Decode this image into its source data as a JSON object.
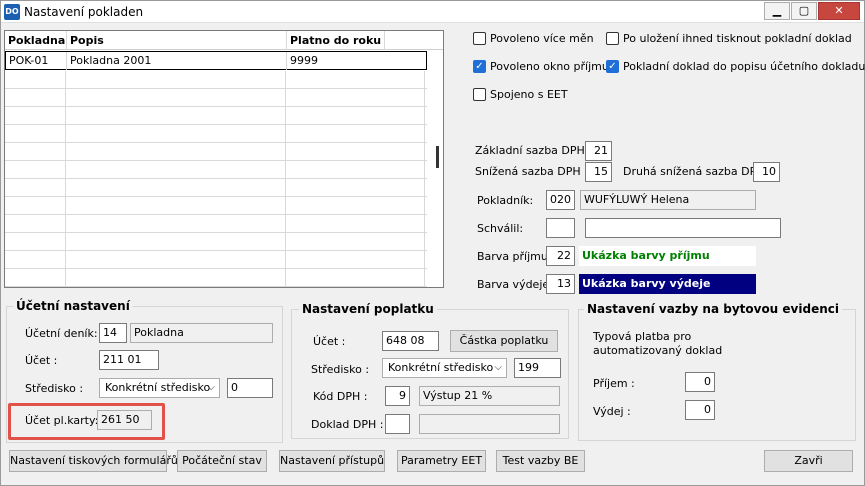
{
  "window": {
    "title": "Nastavení pokladen",
    "app_icon_text": "DO",
    "minimize": "▁",
    "maximize": "▢",
    "close": "✕"
  },
  "grid": {
    "columns": [
      "Pokladna",
      "Popis",
      "Platno do roku"
    ],
    "rows": [
      [
        "POK-01",
        "Pokladna 2001",
        "9999"
      ]
    ]
  },
  "options": {
    "povoleno_vice_men": {
      "label": "Povoleno více měn",
      "checked": false
    },
    "po_ulozeni_tisk": {
      "label": "Po uložení ihned tisknout pokladní doklad",
      "checked": false
    },
    "povoleno_okno_prijmu": {
      "label": "Povoleno okno příjmu",
      "checked": true
    },
    "doklad_do_popisu": {
      "label": "Pokladní doklad do popisu účetního dokladu",
      "checked": true
    },
    "spojeno_s_eet": {
      "label": "Spojeno s EET",
      "checked": false
    }
  },
  "dph": {
    "zakladni_label": "Základní sazba DPH",
    "zakladni_value": "21",
    "snizena_label": "Snížená sazba DPH",
    "snizena_value": "15",
    "druha_label": "Druhá snížená sazba DPH",
    "druha_value": "10"
  },
  "osoby": {
    "pokladnik_label": "Pokladník:",
    "pokladnik_code": "020",
    "pokladnik_name": "WUFÝLUWÝ Helena",
    "schvalil_label": "Schválil:",
    "schvalil_code": "",
    "schvalil_name": ""
  },
  "barvy": {
    "prijem_label": "Barva příjmu:",
    "prijem_value": "22",
    "prijem_sample": "Ukázka barvy příjmu",
    "prijem_color": "#008000",
    "vydej_label": "Barva výdeje:",
    "vydej_value": "13",
    "vydej_sample": "Ukázka barvy výdeje",
    "vydej_color": "#000080"
  },
  "ucetni": {
    "title": "Účetní nastavení",
    "denik_label": "Účetní deník:",
    "denik_code": "14",
    "denik_name": "Pokladna",
    "ucet_label": "Účet :",
    "ucet_value": "211 01",
    "stredisko_label": "Středisko :",
    "stredisko_select": "Konkrétní středisko",
    "stredisko_value": "0",
    "ucet_karty_label": "Účet pl.karty:",
    "ucet_karty_value": "261 50"
  },
  "poplatek": {
    "title": "Nastavení poplatku",
    "ucet_label": "Účet :",
    "ucet_value": "648 08",
    "castka_button": "Částka poplatku",
    "stredisko_label": "Středisko :",
    "stredisko_select": "Konkrétní středisko",
    "stredisko_value": "199",
    "kod_dph_label": "Kód DPH :",
    "kod_dph_value": "9",
    "kod_dph_desc": "Výstup 21 %",
    "doklad_dph_label": "Doklad DPH :",
    "doklad_dph_value": "",
    "doklad_dph_desc": ""
  },
  "vazba": {
    "title": "Nastavení vazby na bytovou evidenci",
    "typova_label": "Typová platba pro automatizovaný doklad",
    "prijem_label": "Příjem :",
    "prijem_value": "0",
    "vydej_label": "Výdej :",
    "vydej_value": "0"
  },
  "buttons": {
    "tiskove": "Nastavení tiskových formulářů",
    "pocatecni": "Počáteční stav",
    "pristupu": "Nastavení přístupů",
    "eet": "Parametry EET",
    "test": "Test vazby BE",
    "zavri": "Zavři"
  }
}
